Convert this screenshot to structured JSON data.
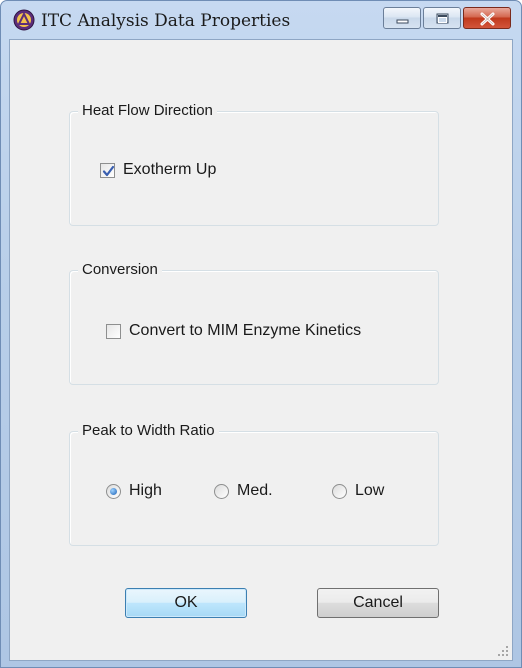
{
  "window": {
    "title": "ITC Analysis Data Properties",
    "app_icon": "itc-app-icon",
    "caption_icons": [
      "minimize-icon",
      "maximize-icon",
      "close-icon"
    ]
  },
  "heat_flow": {
    "group_label": "Heat Flow Direction",
    "exotherm_label": "Exotherm Up",
    "exotherm_checked": true
  },
  "conversion": {
    "group_label": "Conversion",
    "convert_label": "Convert to MIM Enzyme Kinetics",
    "convert_checked": false
  },
  "peak_ratio": {
    "group_label": "Peak to Width Ratio",
    "options": [
      "High",
      "Med.",
      "Low"
    ],
    "selected": "High"
  },
  "buttons": {
    "ok_label": "OK",
    "cancel_label": "Cancel"
  },
  "colors": {
    "titlebar": "#b9cfe9",
    "client_bg": "#f0f0f0",
    "default_button_border": "#3c7fb1",
    "close_button": "#c0391c"
  }
}
